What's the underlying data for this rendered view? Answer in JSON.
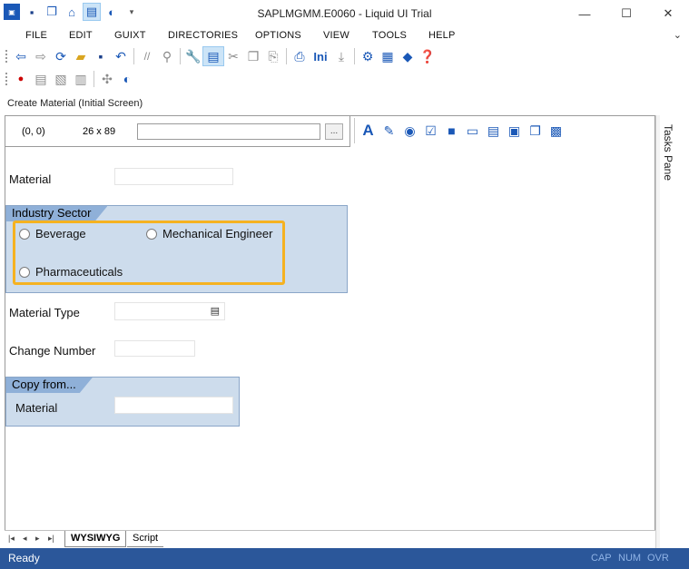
{
  "window": {
    "title": "SAPLMGMM.E0060 - Liquid UI Trial",
    "minimize": "—",
    "maximize": "☐",
    "close": "✕"
  },
  "menu": [
    "FILE",
    "EDIT",
    "GUIXT",
    "DIRECTORIES",
    "OPTIONS",
    "VIEW",
    "TOOLS",
    "HELP"
  ],
  "toolbar": {
    "ini_label": "Ini"
  },
  "screen_title": "Create Material (Initial Screen)",
  "infobar": {
    "coord": "(0, 0)",
    "size": "26 x 89",
    "field_value": "",
    "browse_label": "..."
  },
  "form": {
    "material_label": "Material",
    "material_value": "",
    "industry_sector": {
      "title": "Industry Sector",
      "options": [
        "Beverage",
        "Mechanical Engineer",
        "Pharmaceuticals"
      ]
    },
    "material_type_label": "Material Type",
    "material_type_value": "",
    "change_number_label": "Change Number",
    "change_number_value": "",
    "copy_from": {
      "title": "Copy from...",
      "material_label": "Material",
      "material_value": ""
    }
  },
  "tabs": [
    "WYSIWYG",
    "Script"
  ],
  "tasks_pane": "Tasks Pane",
  "status": {
    "text": "Ready",
    "indicators": [
      "CAP",
      "NUM",
      "OVR"
    ]
  },
  "colors": {
    "statusbar": "#2b579a",
    "group_bg": "#cddcec",
    "group_title": "#8fb0d8",
    "highlight": "#f5b221"
  }
}
